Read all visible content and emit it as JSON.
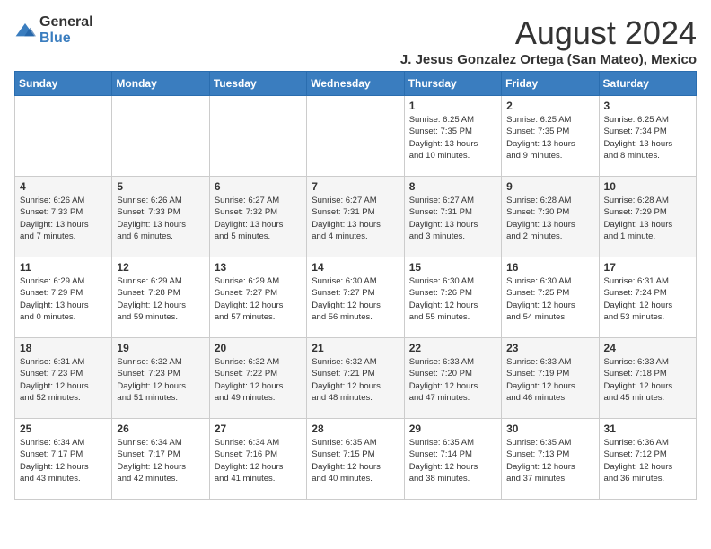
{
  "logo": {
    "general": "General",
    "blue": "Blue"
  },
  "title": "August 2024",
  "subtitle": "J. Jesus Gonzalez Ortega (San Mateo), Mexico",
  "days_of_week": [
    "Sunday",
    "Monday",
    "Tuesday",
    "Wednesday",
    "Thursday",
    "Friday",
    "Saturday"
  ],
  "weeks": [
    [
      {
        "day": "",
        "info": ""
      },
      {
        "day": "",
        "info": ""
      },
      {
        "day": "",
        "info": ""
      },
      {
        "day": "",
        "info": ""
      },
      {
        "day": "1",
        "info": "Sunrise: 6:25 AM\nSunset: 7:35 PM\nDaylight: 13 hours\nand 10 minutes."
      },
      {
        "day": "2",
        "info": "Sunrise: 6:25 AM\nSunset: 7:35 PM\nDaylight: 13 hours\nand 9 minutes."
      },
      {
        "day": "3",
        "info": "Sunrise: 6:25 AM\nSunset: 7:34 PM\nDaylight: 13 hours\nand 8 minutes."
      }
    ],
    [
      {
        "day": "4",
        "info": "Sunrise: 6:26 AM\nSunset: 7:33 PM\nDaylight: 13 hours\nand 7 minutes."
      },
      {
        "day": "5",
        "info": "Sunrise: 6:26 AM\nSunset: 7:33 PM\nDaylight: 13 hours\nand 6 minutes."
      },
      {
        "day": "6",
        "info": "Sunrise: 6:27 AM\nSunset: 7:32 PM\nDaylight: 13 hours\nand 5 minutes."
      },
      {
        "day": "7",
        "info": "Sunrise: 6:27 AM\nSunset: 7:31 PM\nDaylight: 13 hours\nand 4 minutes."
      },
      {
        "day": "8",
        "info": "Sunrise: 6:27 AM\nSunset: 7:31 PM\nDaylight: 13 hours\nand 3 minutes."
      },
      {
        "day": "9",
        "info": "Sunrise: 6:28 AM\nSunset: 7:30 PM\nDaylight: 13 hours\nand 2 minutes."
      },
      {
        "day": "10",
        "info": "Sunrise: 6:28 AM\nSunset: 7:29 PM\nDaylight: 13 hours\nand 1 minute."
      }
    ],
    [
      {
        "day": "11",
        "info": "Sunrise: 6:29 AM\nSunset: 7:29 PM\nDaylight: 13 hours\nand 0 minutes."
      },
      {
        "day": "12",
        "info": "Sunrise: 6:29 AM\nSunset: 7:28 PM\nDaylight: 12 hours\nand 59 minutes."
      },
      {
        "day": "13",
        "info": "Sunrise: 6:29 AM\nSunset: 7:27 PM\nDaylight: 12 hours\nand 57 minutes."
      },
      {
        "day": "14",
        "info": "Sunrise: 6:30 AM\nSunset: 7:27 PM\nDaylight: 12 hours\nand 56 minutes."
      },
      {
        "day": "15",
        "info": "Sunrise: 6:30 AM\nSunset: 7:26 PM\nDaylight: 12 hours\nand 55 minutes."
      },
      {
        "day": "16",
        "info": "Sunrise: 6:30 AM\nSunset: 7:25 PM\nDaylight: 12 hours\nand 54 minutes."
      },
      {
        "day": "17",
        "info": "Sunrise: 6:31 AM\nSunset: 7:24 PM\nDaylight: 12 hours\nand 53 minutes."
      }
    ],
    [
      {
        "day": "18",
        "info": "Sunrise: 6:31 AM\nSunset: 7:23 PM\nDaylight: 12 hours\nand 52 minutes."
      },
      {
        "day": "19",
        "info": "Sunrise: 6:32 AM\nSunset: 7:23 PM\nDaylight: 12 hours\nand 51 minutes."
      },
      {
        "day": "20",
        "info": "Sunrise: 6:32 AM\nSunset: 7:22 PM\nDaylight: 12 hours\nand 49 minutes."
      },
      {
        "day": "21",
        "info": "Sunrise: 6:32 AM\nSunset: 7:21 PM\nDaylight: 12 hours\nand 48 minutes."
      },
      {
        "day": "22",
        "info": "Sunrise: 6:33 AM\nSunset: 7:20 PM\nDaylight: 12 hours\nand 47 minutes."
      },
      {
        "day": "23",
        "info": "Sunrise: 6:33 AM\nSunset: 7:19 PM\nDaylight: 12 hours\nand 46 minutes."
      },
      {
        "day": "24",
        "info": "Sunrise: 6:33 AM\nSunset: 7:18 PM\nDaylight: 12 hours\nand 45 minutes."
      }
    ],
    [
      {
        "day": "25",
        "info": "Sunrise: 6:34 AM\nSunset: 7:17 PM\nDaylight: 12 hours\nand 43 minutes."
      },
      {
        "day": "26",
        "info": "Sunrise: 6:34 AM\nSunset: 7:17 PM\nDaylight: 12 hours\nand 42 minutes."
      },
      {
        "day": "27",
        "info": "Sunrise: 6:34 AM\nSunset: 7:16 PM\nDaylight: 12 hours\nand 41 minutes."
      },
      {
        "day": "28",
        "info": "Sunrise: 6:35 AM\nSunset: 7:15 PM\nDaylight: 12 hours\nand 40 minutes."
      },
      {
        "day": "29",
        "info": "Sunrise: 6:35 AM\nSunset: 7:14 PM\nDaylight: 12 hours\nand 38 minutes."
      },
      {
        "day": "30",
        "info": "Sunrise: 6:35 AM\nSunset: 7:13 PM\nDaylight: 12 hours\nand 37 minutes."
      },
      {
        "day": "31",
        "info": "Sunrise: 6:36 AM\nSunset: 7:12 PM\nDaylight: 12 hours\nand 36 minutes."
      }
    ]
  ]
}
